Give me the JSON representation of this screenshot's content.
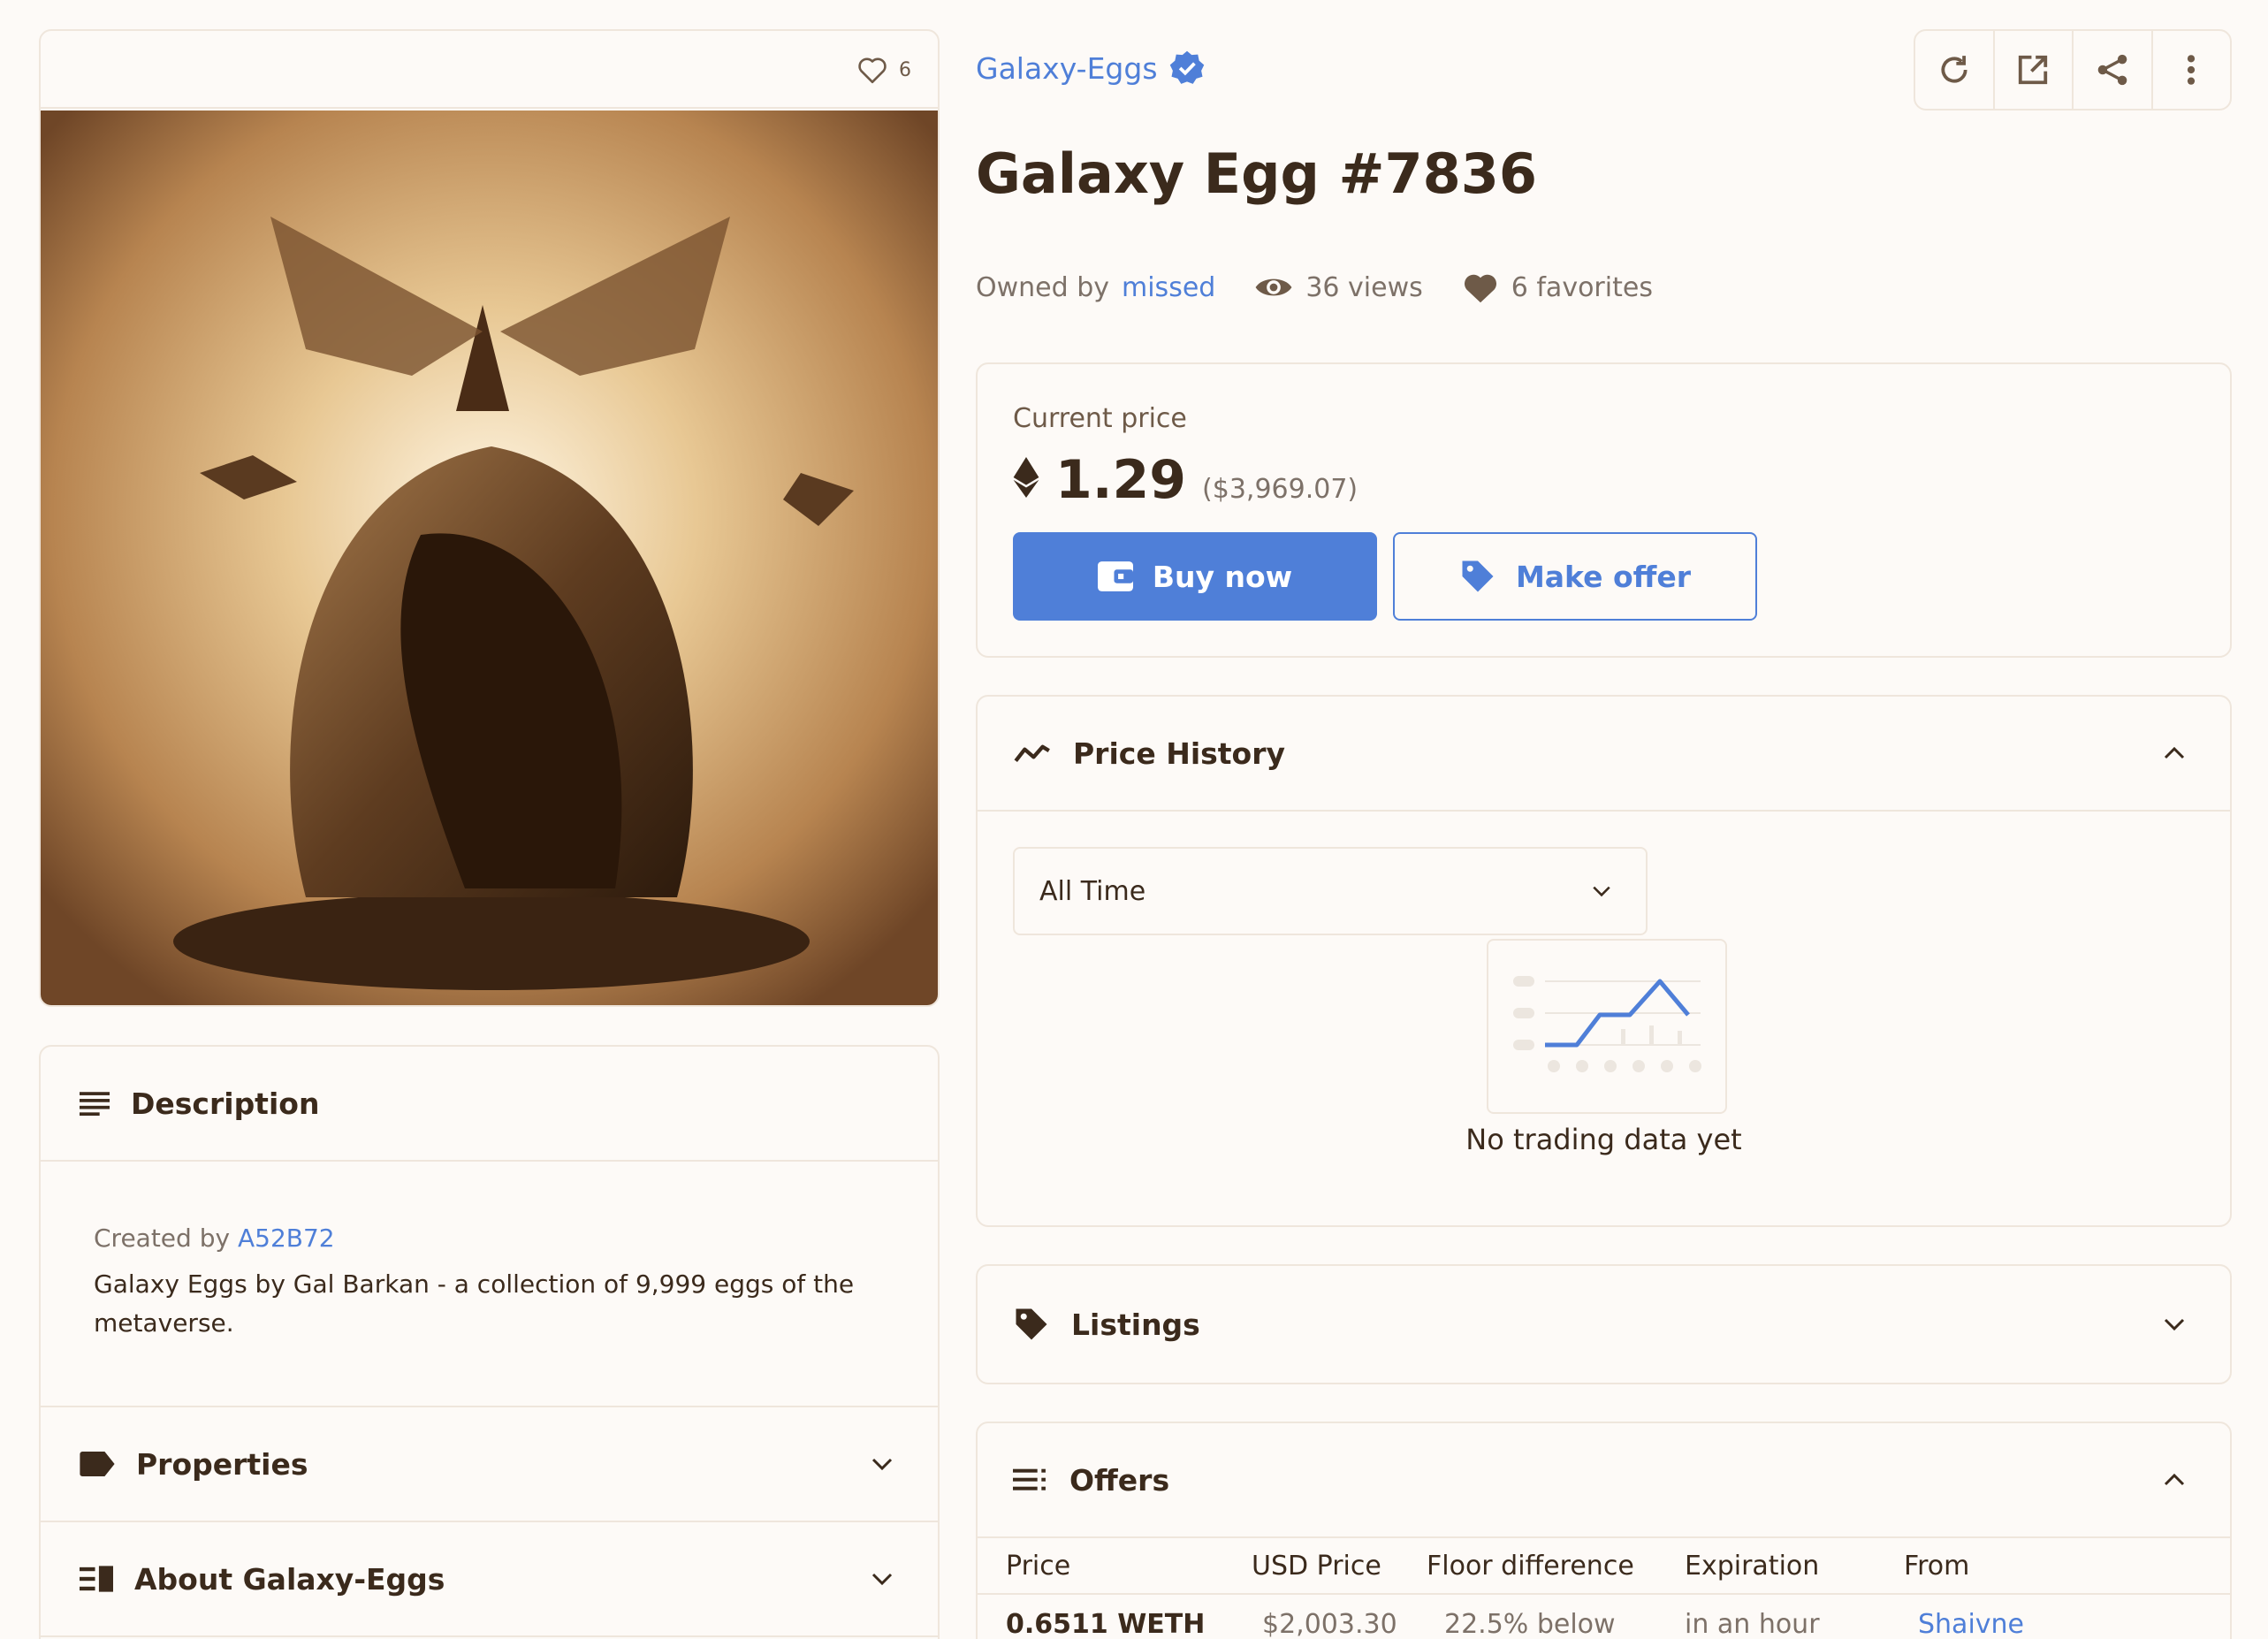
{
  "favorites_count": "6",
  "collection": {
    "name": "Galaxy-Eggs",
    "verified": true
  },
  "nft": {
    "title": "Galaxy Egg #7836",
    "owned_by_label": "Owned by",
    "owner": "missed",
    "views": "36 views",
    "favorites": "6 favorites"
  },
  "toolbar": {
    "icons": [
      "refresh-icon",
      "external-link-icon",
      "share-icon",
      "more-icon"
    ]
  },
  "price": {
    "label": "Current price",
    "value": "1.29",
    "usd": "($3,969.07)",
    "buy_label": "Buy now",
    "offer_label": "Make offer"
  },
  "description": {
    "title": "Description",
    "created_by_label": "Created by",
    "creator": "A52B72",
    "text": "Galaxy Eggs by Gal Barkan - a collection of 9,999 eggs of the metaverse."
  },
  "properties": {
    "title": "Properties"
  },
  "about": {
    "title": "About Galaxy-Eggs"
  },
  "price_history": {
    "title": "Price History",
    "range": "All Time",
    "empty": "No trading data yet"
  },
  "listings": {
    "title": "Listings"
  },
  "offers": {
    "title": "Offers",
    "columns": [
      "Price",
      "USD Price",
      "Floor difference",
      "Expiration",
      "From"
    ],
    "row": {
      "price": "0.6511 WETH",
      "usd": "$2,003.30",
      "floor": "22.5% below",
      "expiration": "in an hour",
      "from": "Shaivne"
    }
  },
  "colors": {
    "accent": "#4f7fd8",
    "text": "#3b2a1c",
    "border": "#efe6dc",
    "bg": "#fdfaf7"
  }
}
